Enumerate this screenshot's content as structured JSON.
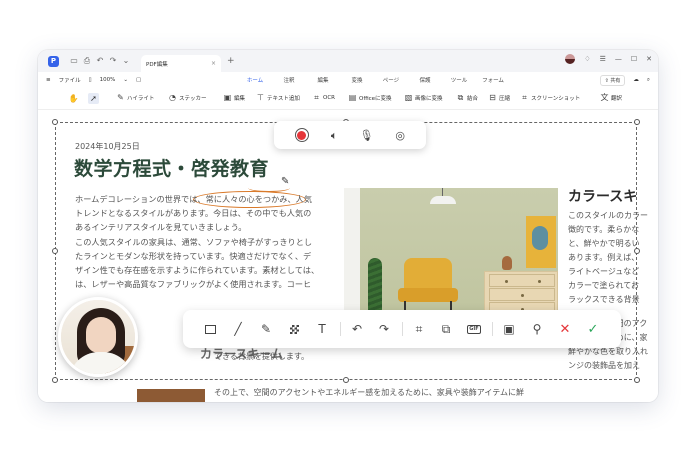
{
  "titlebar": {
    "tab_title": "PDF編集",
    "tab_close": "×",
    "new_tab": "+"
  },
  "menubar": {
    "file": "ファイル",
    "zoom": "100%",
    "tabs": [
      "ホーム",
      "注釈",
      "編集",
      "変換",
      "ページ",
      "保護",
      "ツール",
      "フォーム"
    ],
    "active_tab": "ホーム",
    "share": "共有"
  },
  "toolbar": {
    "items": [
      "ハイライト",
      "ステッカー",
      "編集",
      "テキスト追加",
      "OCR",
      "Officeに変換",
      "画像に変換",
      "結合",
      "圧縮",
      "スクリーンショット",
      "翻訳"
    ]
  },
  "document": {
    "date": "2024年10月25日",
    "headline": "数学方程式・啓発教育",
    "body": [
      "ホームデコレーションの世界では、常に人々の心をつかみ、人気",
      "トレンドとなるスタイルがあります。今日は、その中でも人気の",
      "あるインテリアスタイルを見ていきましょう。",
      "この人気スタイルの家具は、通常、ソファや椅子がすっきりとし",
      "たラインとモダンな形状を持っています。快適さだけでなく、デ",
      "ザイン性でも存在感を示すように作られています。素材としては、",
      "は、レザーや高品質なファブリックがよく使用されます。コーヒ"
    ],
    "sub_heading": "カラースキーム",
    "bottom_line_1": "できる背景を提供します。",
    "bottom_line_2": "その上で、空間のアクセントやエネルギー感を加えるために、家具や装飾アイテムに鮮",
    "right_title": "カラースキ",
    "right_lines_1": [
      "このスタイルのカラー",
      "徴的です。柔らかな",
      "と、鮮やかで明るい",
      "あります。例えば、",
      "ライトベージュなど",
      "カラーで塗られてお",
      "ラックスできる背景"
    ],
    "right_lines_2": [
      "その上で、空間のアク",
      "感を加えるために、家",
      "鮮やかな色を取り入れ",
      "ンジの装飾品を加え"
    ]
  },
  "recording": {
    "record": "record-icon",
    "speaker": "speaker-icon",
    "mic": "microphone-icon",
    "camera": "webcam-icon"
  },
  "colors": {
    "accent": "#3563e9",
    "headline": "#2c4a3a",
    "record_red": "#e5363a",
    "confirm_green": "#2aa65a",
    "annotation_orange": "#d97a2b"
  }
}
